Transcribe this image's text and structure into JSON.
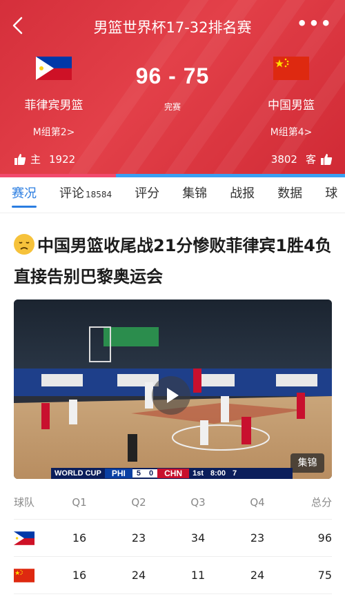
{
  "header": {
    "title": "男篮世界杯17-32排名赛",
    "more_icon": "more-icon",
    "back_icon": "back-icon",
    "score": "96 - 75",
    "status": "完赛",
    "home": {
      "name": "菲律宾男篮",
      "group": "M组第2>",
      "votes": "1922",
      "vote_label": "主",
      "flag": "philippines-flag"
    },
    "away": {
      "name": "中国男篮",
      "group": "M组第4>",
      "votes": "3802",
      "vote_label": "客",
      "flag": "china-flag"
    },
    "vote_share_home": 0.336,
    "colors": {
      "header_red": "#d52f3b",
      "home_bar": "#f24a6d",
      "away_bar": "#3aa0f2"
    }
  },
  "tabs": [
    {
      "label": "赛况",
      "active": true
    },
    {
      "label": "评论",
      "count": "18584"
    },
    {
      "label": "评分"
    },
    {
      "label": "集锦"
    },
    {
      "label": "战报"
    },
    {
      "label": "数据"
    },
    {
      "label": "球"
    }
  ],
  "article": {
    "headline": "中国男篮收尾战21分惨败菲律宾1胜4负直接告别巴黎奥运会",
    "emoji": "disappointed-face-icon",
    "video_tag": "集锦",
    "scorebug": {
      "event": "WORLD CUP",
      "team1": "PHI",
      "score1": "5",
      "score2": "0",
      "team2": "CHN",
      "period": "1st",
      "clock": "8:00",
      "shot": "7"
    }
  },
  "quarters": {
    "headers": [
      "球队",
      "Q1",
      "Q2",
      "Q3",
      "Q4",
      "总分"
    ],
    "rows": [
      {
        "flag": "philippines-flag",
        "q": [
          "16",
          "23",
          "34",
          "23"
        ],
        "total": "96"
      },
      {
        "flag": "china-flag",
        "q": [
          "16",
          "24",
          "11",
          "24"
        ],
        "total": "75"
      }
    ]
  },
  "accent_color": "#2a7de1"
}
